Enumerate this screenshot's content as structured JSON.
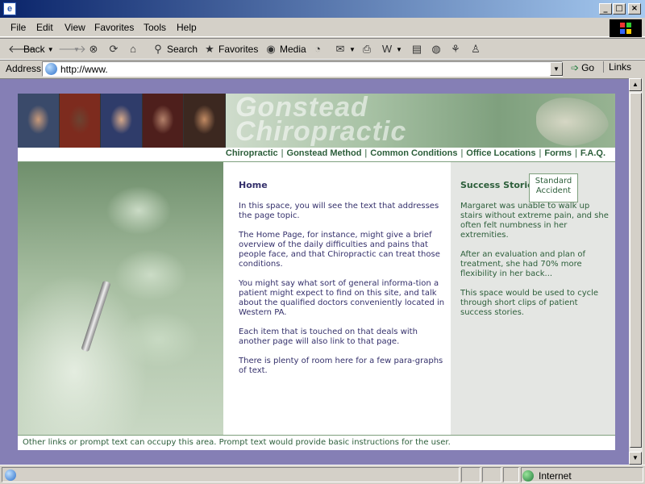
{
  "window": {
    "minimize": "_",
    "maximize": "□",
    "close": "×"
  },
  "menu": [
    "File",
    "Edit",
    "View",
    "Favorites",
    "Tools",
    "Help"
  ],
  "toolbar": {
    "back": "Back",
    "search": "Search",
    "favorites": "Favorites",
    "media": "Media"
  },
  "address": {
    "label": "Address",
    "url": "http://www.",
    "go": "Go",
    "links": "Links"
  },
  "banner": {
    "title": "Gonstead\nChiropractic"
  },
  "nav": [
    "Chiropractic",
    "Gonstead Method",
    "Common Conditions",
    "Office Locations",
    "Forms",
    "F.A.Q."
  ],
  "dropdown": [
    "Standard",
    "Accident"
  ],
  "main": {
    "title": "Home",
    "paragraphs": [
      "In this space, you will see the text that addresses the page topic.",
      "The Home Page, for instance, might give a brief overview of the daily difficulties and pains that people face, and that Chiropractic can treat those conditions.",
      "You might say what sort of general informa-tion a patient might expect to find on this site, and talk about the qualified doctors conveniently located in Western PA.",
      "Each item that is touched on that deals with another page will also link to that page.",
      "There is plenty of room here for a few para-graphs of text."
    ]
  },
  "sidebar": {
    "title": "Success Stories",
    "paragraphs": [
      "Margaret was unable to walk up stairs without extreme pain, and she often felt numbness in her extremities.",
      "After an evaluation and plan of treatment, she had 70% more flexibility in her back...",
      "This space would be used to cycle through short clips of patient success stories."
    ]
  },
  "footer": {
    "text": "Other links or prompt text can occupy this area.   Prompt text would provide basic instructions for the user."
  },
  "status": {
    "zone": "Internet"
  }
}
